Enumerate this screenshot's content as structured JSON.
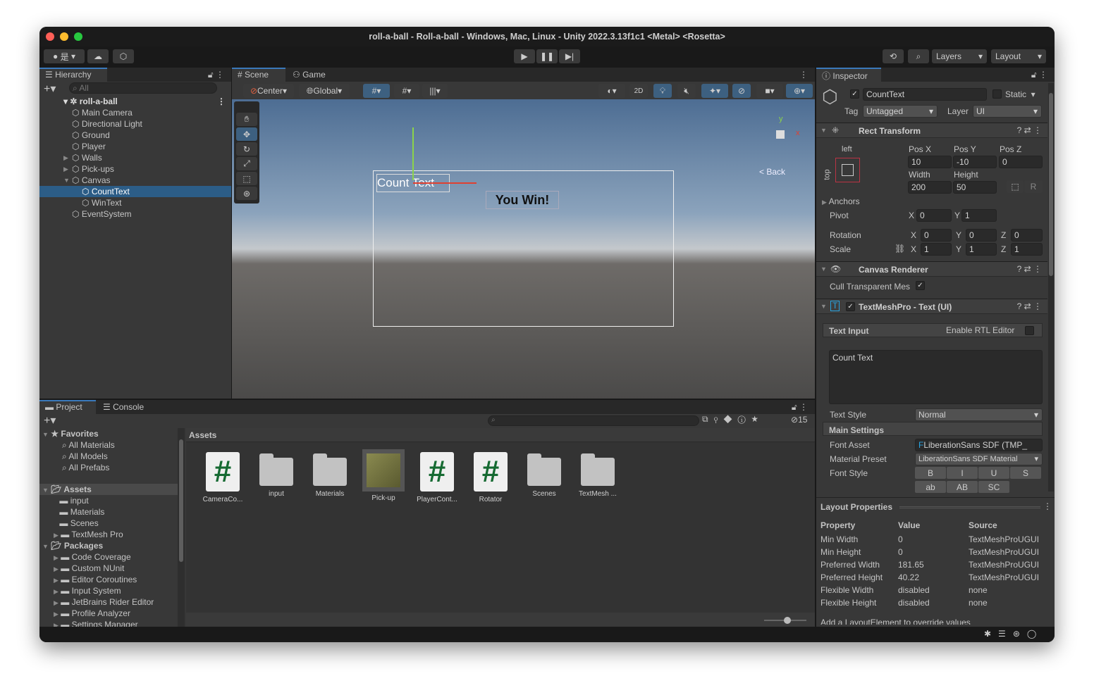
{
  "window": {
    "title": "roll-a-ball - Roll-a-ball - Windows, Mac, Linux - Unity 2022.3.13f1c1 <Metal> <Rosetta>",
    "colors": {
      "close": "#fe5f57",
      "minimize": "#febc2e",
      "maximize": "#28c840",
      "accent": "#2c5d87"
    }
  },
  "toolbar": {
    "account_label": "是",
    "layers": "Layers",
    "layout": "Layout",
    "icons": [
      "account-icon",
      "cloud-icon",
      "collab-icon",
      "play-icon",
      "pause-icon",
      "step-icon",
      "history-icon",
      "search-icon"
    ]
  },
  "hierarchy": {
    "tab": "Hierarchy",
    "search_placeholder": "All",
    "root": "roll-a-ball",
    "items": [
      {
        "label": "Main Camera",
        "depth": 1
      },
      {
        "label": "Directional Light",
        "depth": 1
      },
      {
        "label": "Ground",
        "depth": 1
      },
      {
        "label": "Player",
        "depth": 1
      },
      {
        "label": "Walls",
        "depth": 1,
        "expandable": true
      },
      {
        "label": "Pick-ups",
        "depth": 1,
        "expandable": true
      },
      {
        "label": "Canvas",
        "depth": 1,
        "expanded": true
      },
      {
        "label": "CountText",
        "depth": 2,
        "selected": true
      },
      {
        "label": "WinText",
        "depth": 2
      },
      {
        "label": "EventSystem",
        "depth": 1
      }
    ]
  },
  "scene": {
    "tabs": [
      "Scene",
      "Game"
    ],
    "pivot": "Center",
    "space": "Global",
    "mode_2d": "2D",
    "back": "Back",
    "count_text": "Count Text",
    "win_text": "You Win!",
    "axis_x": "x",
    "axis_y": "y"
  },
  "inspector": {
    "tab": "Inspector",
    "name": "CountText",
    "static": "Static",
    "tag_label": "Tag",
    "tag": "Untagged",
    "layer_label": "Layer",
    "layer": "UI",
    "rect": {
      "title": "Rect Transform",
      "anchor_h": "left",
      "anchor_v": "top",
      "pos_x_l": "Pos X",
      "pos_y_l": "Pos Y",
      "pos_z_l": "Pos Z",
      "pos_x": "10",
      "pos_y": "-10",
      "pos_z": "0",
      "width_l": "Width",
      "height_l": "Height",
      "width": "200",
      "height": "50",
      "r": "R",
      "anchors": "Anchors",
      "pivot": "Pivot",
      "pivot_x": "0",
      "pivot_y": "1",
      "rotation": "Rotation",
      "rot_x": "0",
      "rot_y": "0",
      "rot_z": "0",
      "scale": "Scale",
      "scale_x": "1",
      "scale_y": "1",
      "scale_z": "1",
      "x": "X",
      "y": "Y",
      "z": "Z"
    },
    "canvas_renderer": {
      "title": "Canvas Renderer",
      "cull": "Cull Transparent Mes"
    },
    "tmp": {
      "title": "TextMeshPro - Text (UI)",
      "text_input": "Text Input",
      "rtl": "Enable RTL Editor",
      "text": "Count  Text",
      "text_style_l": "Text Style",
      "text_style": "Normal",
      "main_settings": "Main Settings",
      "font_asset_l": "Font Asset",
      "font_asset": "LiberationSans SDF (TMP_",
      "material_l": "Material Preset",
      "material": "LiberationSans SDF Material",
      "font_style_l": "Font Style",
      "styles": [
        "B",
        "I",
        "U",
        "S"
      ],
      "styles2": [
        "ab",
        "AB",
        "SC"
      ]
    },
    "layout": {
      "title": "Layout Properties",
      "headers": [
        "Property",
        "Value",
        "Source"
      ],
      "rows": [
        [
          "Min Width",
          "0",
          "TextMeshProUGUI"
        ],
        [
          "Min Height",
          "0",
          "TextMeshProUGUI"
        ],
        [
          "Preferred Width",
          "181.65",
          "TextMeshProUGUI"
        ],
        [
          "Preferred Height",
          "40.22",
          "TextMeshProUGUI"
        ],
        [
          "Flexible Width",
          "disabled",
          "none"
        ],
        [
          "Flexible Height",
          "disabled",
          "none"
        ]
      ],
      "note": "Add a LayoutElement to override values"
    }
  },
  "project": {
    "tabs": [
      "Project",
      "Console"
    ],
    "favorites": "Favorites",
    "fav_items": [
      "All Materials",
      "All Models",
      "All Prefabs"
    ],
    "assets": "Assets",
    "asset_folders": [
      "input",
      "Materials",
      "Scenes",
      "TextMesh Pro"
    ],
    "packages": "Packages",
    "package_items": [
      "Code Coverage",
      "Custom NUnit",
      "Editor Coroutines",
      "Input System",
      "JetBrains Rider Editor",
      "Profile Analyzer",
      "Settings Manager"
    ],
    "breadcrumb": "Assets",
    "hidden_count": "15",
    "grid": [
      {
        "label": "CameraCo...",
        "type": "script"
      },
      {
        "label": "input",
        "type": "folder"
      },
      {
        "label": "Materials",
        "type": "folder"
      },
      {
        "label": "Pick-up",
        "type": "prefab"
      },
      {
        "label": "PlayerCont...",
        "type": "script"
      },
      {
        "label": "Rotator",
        "type": "script"
      },
      {
        "label": "Scenes",
        "type": "folder"
      },
      {
        "label": "TextMesh ...",
        "type": "folder"
      }
    ]
  }
}
